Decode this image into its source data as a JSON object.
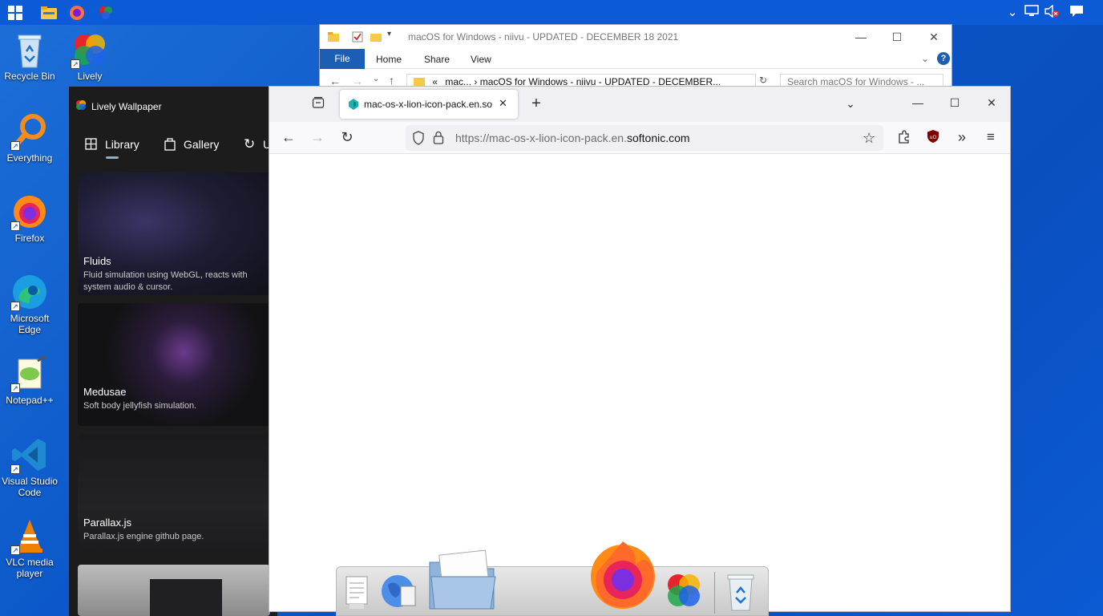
{
  "taskbar": {
    "icons": [
      "windows-start-icon",
      "file-explorer-icon",
      "firefox-icon",
      "lively-icon"
    ],
    "tray": [
      "chevron-up-icon",
      "network-icon",
      "volume-muted-icon",
      "notification-icon"
    ]
  },
  "desktop": {
    "icons": [
      {
        "label": "Recycle Bin",
        "icon": "recycle-bin-icon"
      },
      {
        "label": "Lively",
        "icon": "lively-icon"
      },
      {
        "label": "Everything",
        "icon": "everything-icon"
      },
      {
        "label": "Firefox",
        "icon": "firefox-icon"
      },
      {
        "label": "Microsoft Edge",
        "icon": "edge-icon"
      },
      {
        "label": "Notepad++",
        "icon": "notepad-plus-plus-icon"
      },
      {
        "label": "Visual Studio Code",
        "icon": "vscode-icon"
      },
      {
        "label": "VLC media player",
        "icon": "vlc-icon"
      }
    ]
  },
  "explorer": {
    "title": "macOS for Windows - niivu - UPDATED - DECEMBER 18 2021",
    "ribbon": {
      "file": "File",
      "home": "Home",
      "share": "Share",
      "view": "View"
    },
    "address": "mac...  ›  macOS for Windows - niivu - UPDATED - DECEMBER...",
    "address_prefix": "«",
    "search_placeholder": "Search macOS for Windows - ..."
  },
  "lively": {
    "title": "Lively Wallpaper",
    "nav": {
      "library": "Library",
      "gallery": "Gallery",
      "update": "U"
    },
    "cards": [
      {
        "name": "Fluids",
        "desc": "Fluid simulation using WebGL, reacts with system audio & cursor."
      },
      {
        "name": "Medusae",
        "desc": "Soft body jellyfish simulation."
      },
      {
        "name": "Parallax.js",
        "desc": "Parallax.js engine github page."
      },
      {
        "name": "",
        "desc": ""
      }
    ]
  },
  "firefox": {
    "tab_title": "mac-os-x-lion-icon-pack.en.so",
    "url_prefix": "https://mac-os-x-lion-icon-pack.en.",
    "url_domain": "softonic.com"
  },
  "dock": {
    "icons": [
      "textedit-icon",
      "network-globe-icon",
      "folder-icon",
      "firefox-icon",
      "lively-icon",
      "trash-icon"
    ]
  },
  "colors": {
    "taskbar": "#0c5ad6",
    "explorer_file_tab": "#1a5fb4",
    "lively_bg": "#1c1c1c"
  }
}
